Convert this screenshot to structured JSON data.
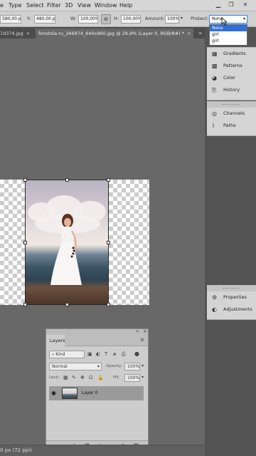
{
  "menubar": {
    "items": [
      "e",
      "Type",
      "Select",
      "Filter",
      "3D",
      "View",
      "Window",
      "Help"
    ],
    "window_controls": [
      "minimize",
      "maximize",
      "close"
    ]
  },
  "options": {
    "x_value": "580,00 px",
    "y_label": "Y:",
    "y_value": "480,00 px",
    "w_label": "W:",
    "w_value": "100,00%",
    "h_label": "H:",
    "h_value": "100,00%",
    "amount_label": "Amount:",
    "amount_value": "100%",
    "protect_label": "Protect:",
    "protect_value": "None",
    "protect_options": [
      "None",
      "girl",
      "girl"
    ],
    "protect_selected_index": 0
  },
  "tabs": [
    {
      "label": "7d374.jpg",
      "active": false
    },
    {
      "label": "fonstola.ru_266974_640x960.jpg @ 29,9% (Layer 0, RGB/8#) *",
      "active": true
    }
  ],
  "right_panels": {
    "group1": [
      {
        "label": "Gradients",
        "icon": "gradients-icon"
      },
      {
        "label": "Patterns",
        "icon": "patterns-icon"
      },
      {
        "label": "Color",
        "icon": "color-icon"
      },
      {
        "label": "History",
        "icon": "history-icon"
      }
    ],
    "group2": [
      {
        "label": "Channels",
        "icon": "channels-icon"
      },
      {
        "label": "Paths",
        "icon": "paths-icon"
      }
    ],
    "group3": [
      {
        "label": "Properties",
        "icon": "properties-icon"
      },
      {
        "label": "Adjustments",
        "icon": "adjustments-icon"
      }
    ]
  },
  "layers": {
    "tab_label": "Layers",
    "kind_placeholder": "Kind",
    "blend_mode": "Normal",
    "opacity_label": "Opacity:",
    "opacity_value": "100%",
    "lock_label": "Lock:",
    "fill_label": "Fill:",
    "fill_value": "100%",
    "layer_name": "Layer 0"
  },
  "status": {
    "text": "0 px (72 ppi)"
  },
  "colors": {
    "canvas": "#686868",
    "panel": "#d4d4d4",
    "selection": "#2f6fd6"
  }
}
